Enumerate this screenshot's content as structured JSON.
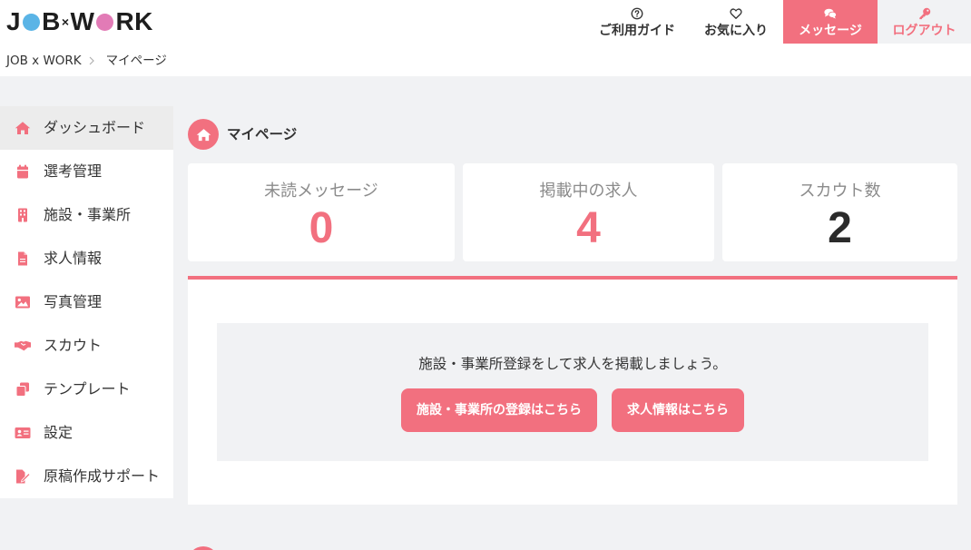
{
  "colors": {
    "accent": "#f2707f",
    "page_bg": "#f1f2f4",
    "text": "#333333",
    "muted": "#8a8a8a",
    "logo_blue": "#5ab4e6",
    "logo_pink": "#e27bb6"
  },
  "header": {
    "logo": {
      "p1": "J",
      "p2": "B",
      "cross": "×",
      "p3": "W",
      "p4": "RK"
    },
    "nav": {
      "guide": {
        "label": "ご利用ガイド",
        "icon": "question-circle-icon"
      },
      "favorites": {
        "label": "お気に入り",
        "icon": "heart-icon"
      },
      "messages": {
        "label": "メッセージ",
        "icon": "comments-icon",
        "active": true
      },
      "logout": {
        "label": "ログアウト",
        "icon": "key-icon"
      }
    }
  },
  "breadcrumb": {
    "items": [
      "JOB x WORK",
      "マイページ"
    ],
    "separator_icon": "chevron-right-icon"
  },
  "sidebar": {
    "items": [
      {
        "label": "ダッシュボード",
        "icon": "home-icon",
        "active": true
      },
      {
        "label": "選考管理",
        "icon": "calendar-icon"
      },
      {
        "label": "施設・事業所",
        "icon": "building-icon"
      },
      {
        "label": "求人情報",
        "icon": "file-icon"
      },
      {
        "label": "写真管理",
        "icon": "image-icon"
      },
      {
        "label": "スカウト",
        "icon": "handshake-icon"
      },
      {
        "label": "テンプレート",
        "icon": "copy-icon"
      },
      {
        "label": "設定",
        "icon": "id-card-icon"
      },
      {
        "label": "原稿作成サポート",
        "icon": "file-signature-icon"
      }
    ]
  },
  "main": {
    "title": "マイページ",
    "title_icon": "home-icon",
    "stats": [
      {
        "label": "未読メッセージ",
        "value": 0
      },
      {
        "label": "掲載中の求人",
        "value": 4
      },
      {
        "label": "スカウト数",
        "value": 2
      }
    ],
    "notice": {
      "message": "施設・事業所登録をして求人を掲載しましょう。",
      "buttons": [
        {
          "label": "施設・事業所の登録はこちら"
        },
        {
          "label": "求人情報はこちら"
        }
      ]
    }
  }
}
